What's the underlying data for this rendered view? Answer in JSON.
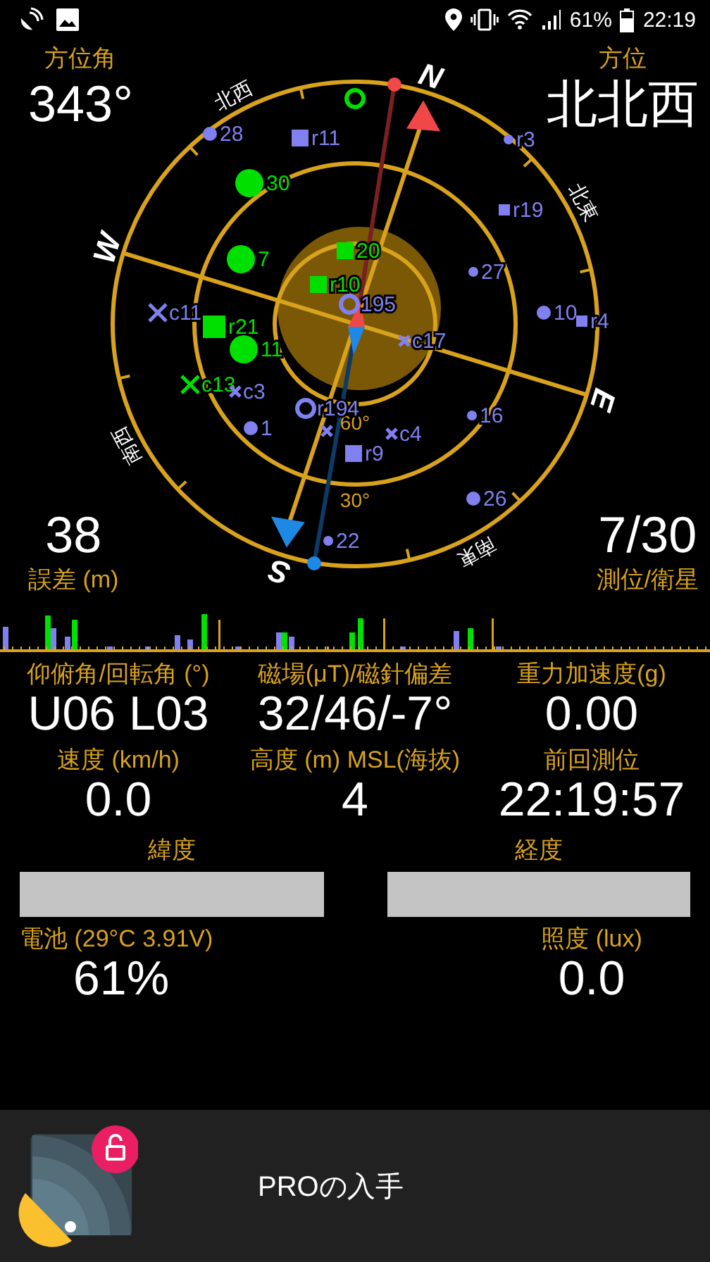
{
  "status_bar": {
    "battery": "61%",
    "time": "22:19"
  },
  "heading": {
    "label": "方位角",
    "value": "343°"
  },
  "direction": {
    "label": "方位",
    "value": "北北西"
  },
  "compass": {
    "cardinals": [
      "N",
      "E",
      "S",
      "W"
    ],
    "intercardinals": [
      "北東",
      "南東",
      "南西",
      "北西"
    ],
    "rings": [
      "60°",
      "30°"
    ]
  },
  "satellites": [
    {
      "kind": "ring",
      "color": "#00e000"
    },
    {
      "label": "28",
      "kind": "dot",
      "color": "#8080f0"
    },
    {
      "label": "r11",
      "kind": "square",
      "color": "#8080f0"
    },
    {
      "label": "r3",
      "kind": "dot-small",
      "color": "#8080f0"
    },
    {
      "label": "30",
      "kind": "dot-big",
      "color": "#00e000"
    },
    {
      "label": "r19",
      "kind": "square-small",
      "color": "#8080f0"
    },
    {
      "label": "20",
      "kind": "square",
      "color": "#00e000"
    },
    {
      "label": "7",
      "kind": "dot-big",
      "color": "#00e000"
    },
    {
      "label": "27",
      "kind": "dot-small",
      "color": "#8080f0"
    },
    {
      "label": "r10",
      "kind": "square",
      "color": "#00e000"
    },
    {
      "label": "195",
      "kind": "ring",
      "color": "#8080f0"
    },
    {
      "label": "c11",
      "kind": "cross",
      "color": "#8080f0"
    },
    {
      "label": "r21",
      "kind": "square-big",
      "color": "#00e000"
    },
    {
      "label": "10",
      "kind": "dot",
      "color": "#8080f0"
    },
    {
      "label": "r4",
      "kind": "square-small",
      "color": "#8080f0"
    },
    {
      "label": "11",
      "kind": "dot-big",
      "color": "#00e000"
    },
    {
      "label": "c17",
      "kind": "cross-small",
      "color": "#8080f0"
    },
    {
      "label": "c13",
      "kind": "cross",
      "color": "#00e000"
    },
    {
      "label": "c3",
      "kind": "cross-small",
      "color": "#8080f0"
    },
    {
      "label": "r194",
      "kind": "ring",
      "color": "#8080f0"
    },
    {
      "label": "16",
      "kind": "dot-small",
      "color": "#8080f0"
    },
    {
      "label": "1",
      "kind": "dot",
      "color": "#8080f0"
    },
    {
      "kind": "cross-small",
      "color": "#8080f0"
    },
    {
      "label": "r9",
      "kind": "square",
      "color": "#8080f0"
    },
    {
      "label": "c4",
      "kind": "cross-small",
      "color": "#8080f0"
    },
    {
      "label": "26",
      "kind": "dot",
      "color": "#8080f0"
    },
    {
      "label": "22",
      "kind": "dot-small",
      "color": "#8080f0"
    }
  ],
  "accuracy": {
    "value": "38",
    "label": "誤差 (m)"
  },
  "fix": {
    "value": "7/30",
    "label": "測位/衛星"
  },
  "readings": [
    {
      "label": "仰俯角/回転角 (°)",
      "value": "U06 L03"
    },
    {
      "label": "磁場(μT)/磁針偏差",
      "value": "32/46/-7°"
    },
    {
      "label": "重力加速度(g)",
      "value": "0.00"
    },
    {
      "label": "速度 (km/h)",
      "value": "0.0"
    },
    {
      "label": "高度 (m) MSL(海抜)",
      "value": "4"
    },
    {
      "label": "前回測位",
      "value": "22:19:57"
    }
  ],
  "coordinates": [
    {
      "label": "緯度"
    },
    {
      "label": "経度"
    }
  ],
  "sensors": [
    {
      "label": "電池 (29°C 3.91V)",
      "value": "61%"
    },
    {
      "label": "照度 (lux)",
      "value": "0.0"
    }
  ],
  "promo": {
    "label": "PROの入手"
  }
}
